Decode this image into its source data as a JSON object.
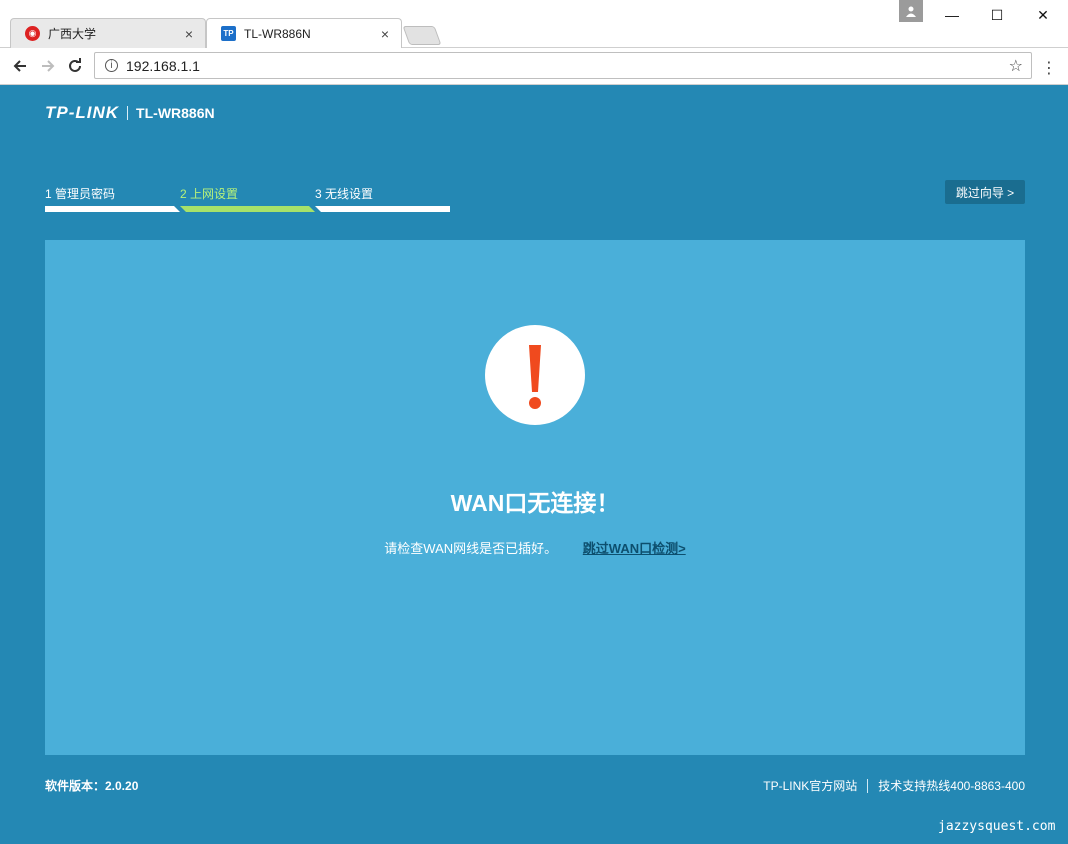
{
  "browser": {
    "tabs": [
      {
        "title": "广西大学",
        "close": "×"
      },
      {
        "title": "TL-WR886N",
        "close": "×",
        "favicon_text": "TP"
      }
    ],
    "address": "192.168.1.1",
    "controls": {
      "minimize": "—",
      "maximize": "☐",
      "close": "✕"
    }
  },
  "router": {
    "brand_logo": "TP-LINK",
    "model": "TL-WR886N",
    "steps": [
      {
        "label": "1 管理员密码",
        "active": false
      },
      {
        "label": "2 上网设置",
        "active": true
      },
      {
        "label": "3 无线设置",
        "active": false
      }
    ],
    "skip_wizard": "跳过向导 >",
    "alert": {
      "title": "WAN口无连接！",
      "message": "请检查WAN网线是否已插好。",
      "skip_link": "跳过WAN口检测>"
    },
    "footer": {
      "version": "软件版本：2.0.20",
      "official_site": "TP-LINK官方网站",
      "hotline": "技术支持热线400-8863-400"
    },
    "watermark": "jazzysquest.com",
    "colors": {
      "page_bg": "#2488b4",
      "panel_bg": "#4aafd9",
      "active_step": "#a6e26a",
      "alert_icon": "#f04a1e"
    }
  }
}
